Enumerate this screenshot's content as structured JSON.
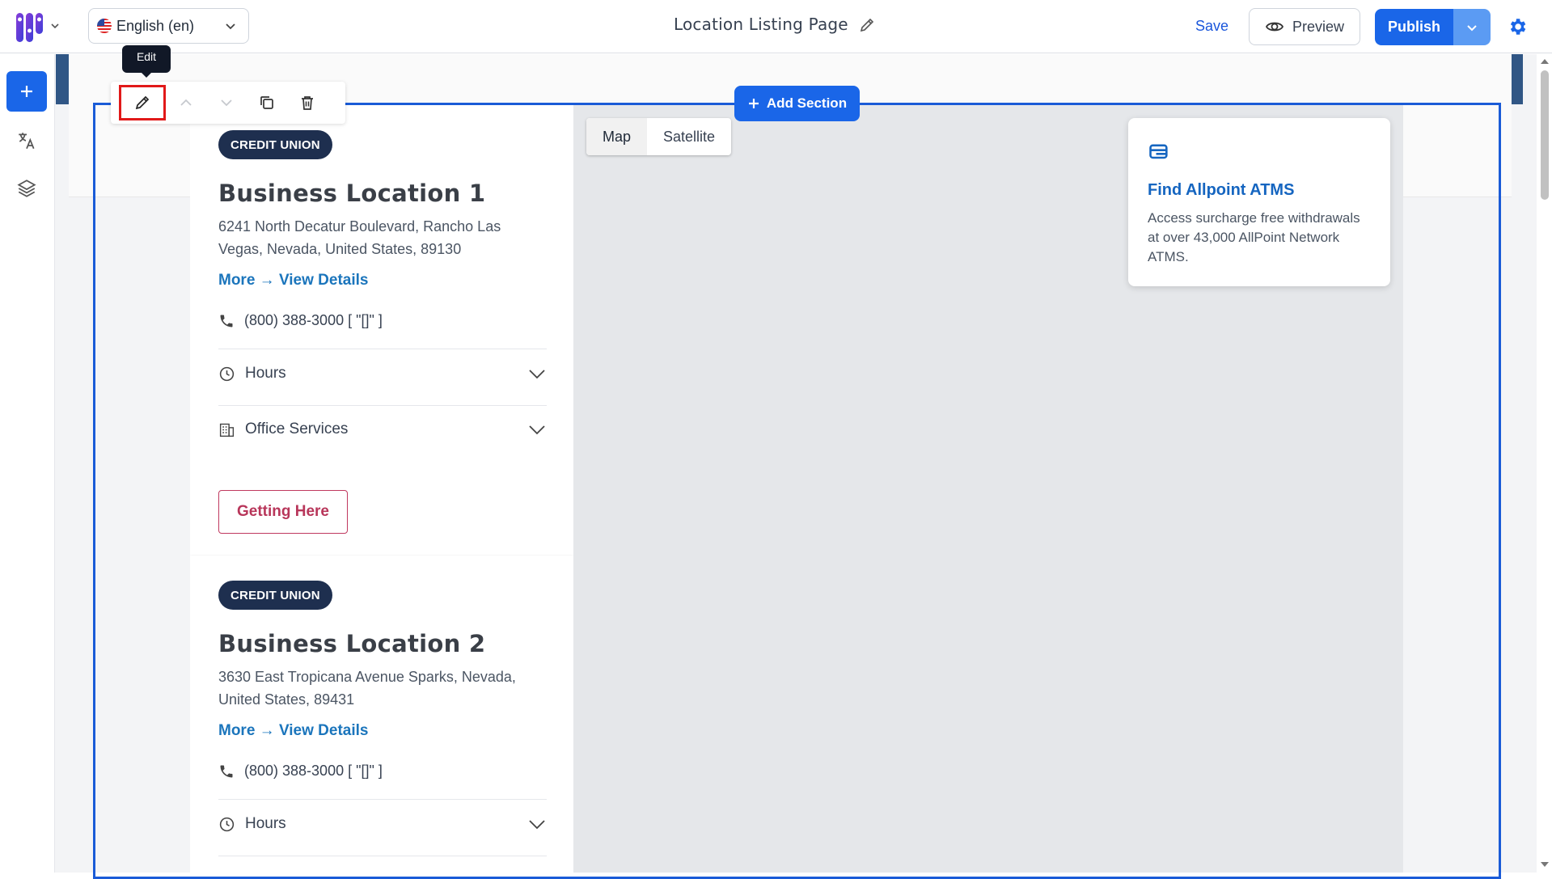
{
  "header": {
    "language": "English (en)",
    "page_title": "Location Listing Page",
    "save_label": "Save",
    "preview_label": "Preview",
    "publish_label": "Publish"
  },
  "editor": {
    "tooltip": "Edit",
    "add_section_label": "Add Section"
  },
  "locations": [
    {
      "badge": "CREDIT UNION",
      "name": "Business Location 1",
      "address": "6241 North Decatur Boulevard, Rancho Las Vegas, Nevada, United States, 89130",
      "more_label": "More → View Details",
      "phone": "(800) 388-3000  [ \"[]\" ]",
      "hours_label": "Hours",
      "services_label": "Office Services",
      "getting_here_label": "Getting Here"
    },
    {
      "badge": "CREDIT UNION",
      "name": "Business Location 2",
      "address": "3630 East Tropicana Avenue Sparks, Nevada, United States, 89431",
      "more_label": "More → View Details",
      "phone": "(800) 388-3000  [ \"[]\" ]",
      "hours_label": "Hours"
    }
  ],
  "map": {
    "type_options": [
      "Map",
      "Satellite"
    ],
    "atm_card": {
      "title": "Find Allpoint ATMS",
      "description": "Access surcharge free withdrawals at over 43,000 AllPoint Network ATMS."
    }
  },
  "colors": {
    "primary": "#1a66e8",
    "badge": "#1e2f4f",
    "link": "#1b75bc",
    "cta": "#b8365a",
    "highlight": "#e11919"
  }
}
